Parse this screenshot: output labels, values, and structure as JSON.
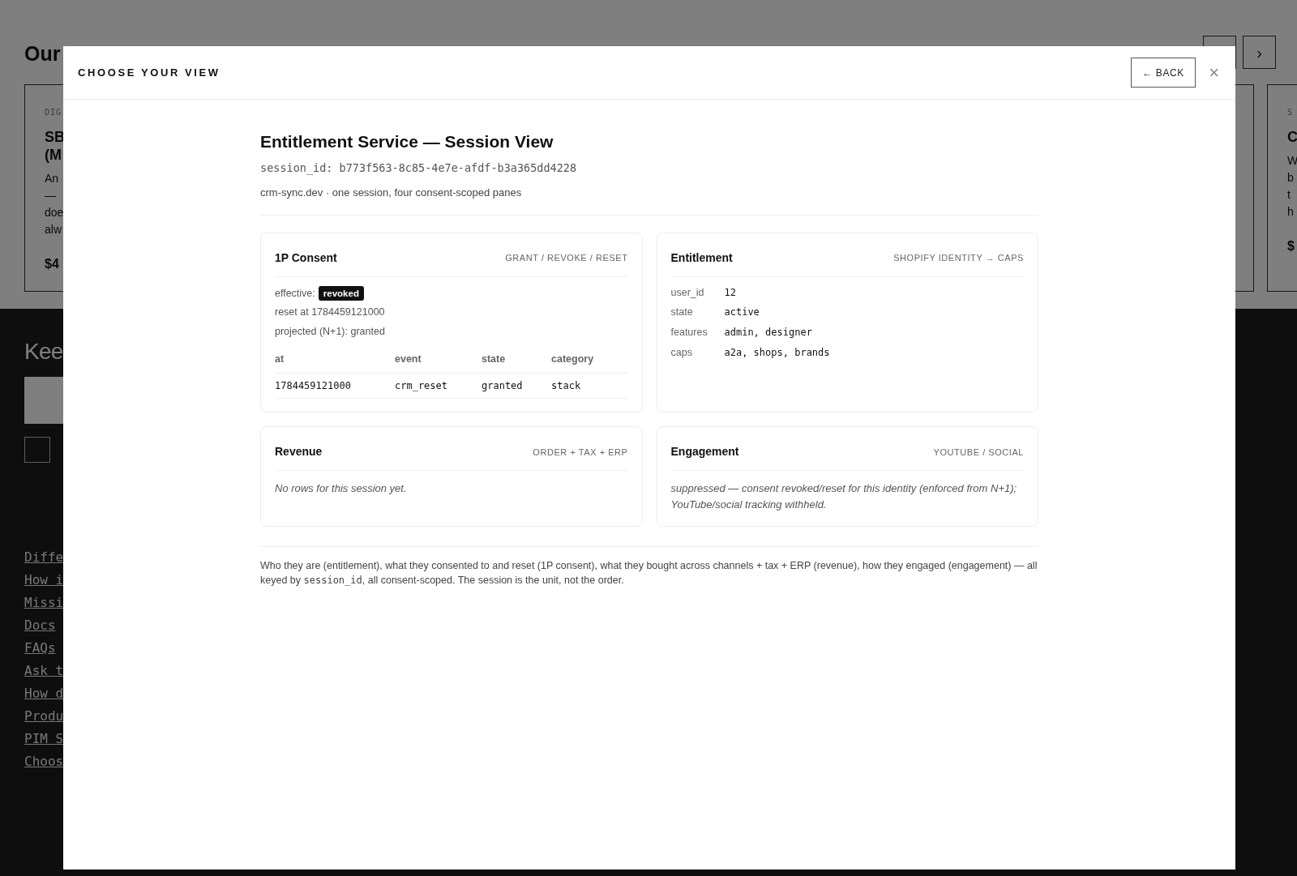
{
  "page": {
    "heading": "Our",
    "carousel_buttons": [
      {
        "kind": "previous"
      },
      {
        "kind": "next",
        "label": "›"
      }
    ],
    "cards": [
      {
        "eyebrow": "DIG",
        "title_lines": [
          "SB",
          "(M"
        ],
        "description_lines": [
          "An",
          "—",
          "doe",
          "alw"
        ],
        "price": "$4"
      },
      {
        "eyebrow": "S",
        "title_lines": [
          "C"
        ],
        "description_lines": [
          "W",
          "b",
          "t",
          "h"
        ],
        "price": "$"
      }
    ],
    "footer": {
      "heading": "Kee",
      "checkbox": {
        "checked": false
      },
      "links": [
        "Diffe",
        "How i",
        "Missi",
        "Docs",
        "FAQs",
        "Ask t",
        "How d",
        "Produ",
        "PIM S",
        "Choos"
      ]
    }
  },
  "modal": {
    "title": "CHOOSE YOUR VIEW",
    "back_button": "← BACK",
    "close": "×",
    "heading": "Entitlement Service — Session View",
    "session_id": "session_id: b773f563-8c85-4e7e-afdf-b3a365dd4228",
    "subtitle": "crm-sync.dev · one session, four consent-scoped panes",
    "panels": [
      {
        "kind": "consent",
        "title": "1P Consent",
        "tag": "GRANT / REVOKE / RESET",
        "effective_label": "effective:",
        "effective_badge": "revoked",
        "lines": [
          "reset at 1784459121000",
          "projected (N+1): granted"
        ],
        "columns": [
          "at",
          "event",
          "state",
          "category"
        ],
        "rows": [
          [
            "1784459121000",
            "crm_reset",
            "granted",
            "stack"
          ]
        ]
      },
      {
        "kind": "kv",
        "title": "Entitlement",
        "tag": "SHOPIFY IDENTITY → CAPS",
        "pairs": [
          {
            "key": "user_id",
            "value": "12"
          },
          {
            "key": "state",
            "value": "active"
          },
          {
            "key": "features",
            "value": "admin, designer"
          },
          {
            "key": "caps",
            "value": "a2a, shops, brands"
          }
        ]
      },
      {
        "kind": "note",
        "title": "Revenue",
        "tag": "ORDER + TAX + ERP",
        "note": "No rows for this session yet."
      },
      {
        "kind": "note",
        "title": "Engagement",
        "tag": "YOUTUBE / SOCIAL",
        "note": "suppressed — consent revoked/reset for this identity (enforced from N+1); YouTube/social tracking withheld."
      }
    ],
    "footnote": {
      "before": "Who they are (entitlement), what they consented to and reset (1P consent), what they bought across channels + tax + ERP (revenue), how they engaged (engagement) — all keyed by ",
      "code": "session_id",
      "after": ", all consent-scoped. The session is the unit, not the order."
    }
  }
}
